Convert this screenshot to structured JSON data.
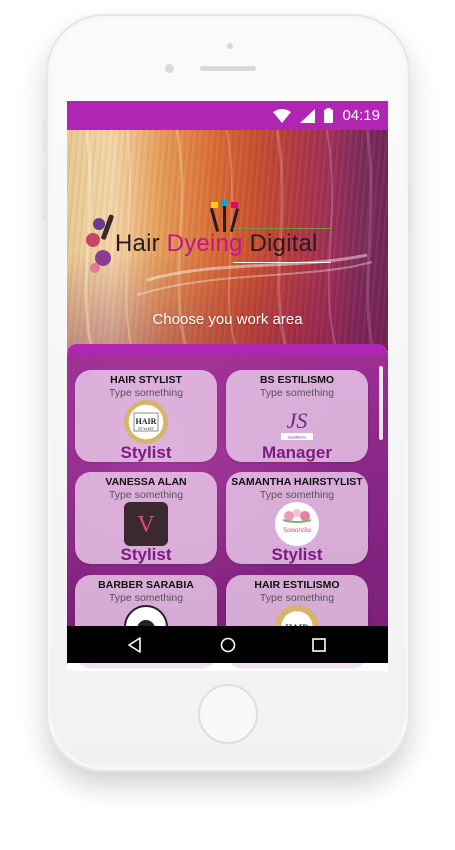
{
  "status": {
    "time": "04:19"
  },
  "app": {
    "logo": {
      "word1": "Hair ",
      "word2": "Dyeing",
      "word3": " Digital"
    },
    "subtitle": "Choose you work area"
  },
  "cards": [
    {
      "name": "HAIR STYLIST",
      "placeholder": "Type something",
      "role": "Stylist",
      "avatar": "hair-stylist-logo"
    },
    {
      "name": "BS ESTILISMO",
      "placeholder": "Type something",
      "role": "Manager",
      "avatar": "bs-estilismo-logo"
    },
    {
      "name": "VANESSA ALAN",
      "placeholder": "Type something",
      "role": "Stylist",
      "avatar": "vanessa-alan-logo"
    },
    {
      "name": "SAMANTHA HAIRSTYLIST",
      "placeholder": "Type something",
      "role": "Stylist",
      "avatar": "samantha-logo"
    },
    {
      "name": "BARBER SARABIA",
      "placeholder": "Type something",
      "role": "",
      "avatar": "barber-sarabia-logo"
    },
    {
      "name": "HAIR ESTILISMO",
      "placeholder": "Type something",
      "role": "",
      "avatar": "hair-estilismo-logo"
    }
  ],
  "colors": {
    "accent": "#b025b3",
    "role_text": "#7d1a7f"
  }
}
